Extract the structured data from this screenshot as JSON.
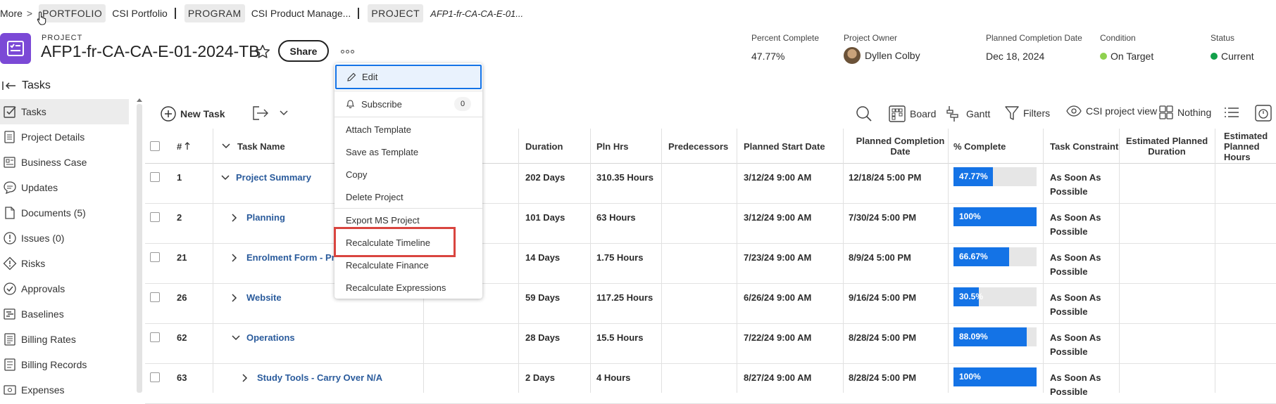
{
  "breadcrumb": {
    "more": "More",
    "portfolio_tag": "PORTFOLIO",
    "portfolio_name": "CSI Portfolio",
    "program_tag": "PROGRAM",
    "program_name": "CSI Product Manage...",
    "project_tag": "PROJECT",
    "project_name": "AFP1-fr-CA-CA-E-01..."
  },
  "header": {
    "label": "PROJECT",
    "title": "AFP1-fr-CA-CA-E-01-2024-TB",
    "share_label": "Share",
    "percent_complete_label": "Percent Complete",
    "percent_complete_value": "47.77%",
    "owner_label": "Project Owner",
    "owner_value": "Dyllen Colby",
    "planned_completion_label": "Planned Completion Date",
    "planned_completion_value": "Dec 18, 2024",
    "condition_label": "Condition",
    "condition_value": "On Target",
    "status_label": "Status",
    "status_value": "Current"
  },
  "colors": {
    "accent": "#1473e6",
    "project_icon": "#7b49d6",
    "condition_dot": "#8fd14f",
    "status_dot": "#12a04a",
    "highlight": "#d9453f",
    "task_link": "#2a5b9c"
  },
  "nav": {
    "title": "Tasks",
    "items": [
      {
        "label": "Tasks",
        "icon": "checkbox-icon"
      },
      {
        "label": "Project Details",
        "icon": "document-icon"
      },
      {
        "label": "Business Case",
        "icon": "business-case-icon"
      },
      {
        "label": "Updates",
        "icon": "chat-icon"
      },
      {
        "label": "Documents (5)",
        "icon": "file-icon"
      },
      {
        "label": "Issues (0)",
        "icon": "alert-icon"
      },
      {
        "label": "Risks",
        "icon": "warning-diamond-icon"
      },
      {
        "label": "Approvals",
        "icon": "approval-check-icon"
      },
      {
        "label": "Baselines",
        "icon": "baseline-icon"
      },
      {
        "label": "Billing Rates",
        "icon": "billing-rates-icon"
      },
      {
        "label": "Billing Records",
        "icon": "billing-records-icon"
      },
      {
        "label": "Expenses",
        "icon": "expenses-icon"
      }
    ]
  },
  "toolbar": {
    "new_task": "New Task",
    "board": "Board",
    "gantt": "Gantt",
    "filters": "Filters",
    "view": "CSI project view",
    "grouping": "Nothing"
  },
  "table": {
    "headers": {
      "num": "#",
      "task_name": "Task Name",
      "duration": "Duration",
      "pln_hrs": "Pln Hrs",
      "predecessors": "Predecessors",
      "planned_start": "Planned Start Date",
      "planned_completion_1": "Planned Completion",
      "planned_completion_2": "Date",
      "percent_complete": "% Complete",
      "task_constraint": "Task Constraint",
      "est_planned_duration_1": "Estimated Planned",
      "est_planned_duration_2": "Duration",
      "est_planned_hours_1": "Estimated",
      "est_planned_hours_2": "Planned Hours"
    },
    "rows": [
      {
        "num": "1",
        "name": "Project Summary",
        "expanded": true,
        "duration": "202 Days",
        "hours": "310.35 Hours",
        "start": "3/12/24 9:00 AM",
        "completion": "12/18/24 5:00 PM",
        "pct": 47.77,
        "pct_label": "47.77%",
        "constraint_1": "As Soon As",
        "constraint_2": "Possible"
      },
      {
        "num": "2",
        "name": "Planning",
        "expanded": false,
        "duration": "101 Days",
        "hours": "63 Hours",
        "start": "3/12/24 9:00 AM",
        "completion": "7/30/24 5:00 PM",
        "pct": 100,
        "pct_label": "100%",
        "constraint_1": "As Soon As",
        "constraint_2": "Possible"
      },
      {
        "num": "21",
        "name": "Enrolment Form - Pr",
        "expanded": false,
        "duration": "14 Days",
        "hours": "1.75 Hours",
        "start": "7/23/24 9:00 AM",
        "completion": "8/9/24 5:00 PM",
        "pct": 66.67,
        "pct_label": "66.67%",
        "constraint_1": "As Soon As",
        "constraint_2": "Possible"
      },
      {
        "num": "26",
        "name": "Website",
        "expanded": false,
        "duration": "59 Days",
        "hours": "117.25 Hours",
        "start": "6/26/24 9:00 AM",
        "completion": "9/16/24 5:00 PM",
        "pct": 30.5,
        "pct_label": "30.5%",
        "constraint_1": "As Soon As",
        "constraint_2": "Possible"
      },
      {
        "num": "62",
        "name": "Operations",
        "expanded": true,
        "duration": "28 Days",
        "hours": "15.5 Hours",
        "start": "7/22/24 9:00 AM",
        "completion": "8/28/24 5:00 PM",
        "pct": 88.09,
        "pct_label": "88.09%",
        "constraint_1": "As Soon As",
        "constraint_2": "Possible"
      },
      {
        "num": "63",
        "name": "Study Tools - Carry Over N/A",
        "expanded": false,
        "duration": "2 Days",
        "hours": "4 Hours",
        "start": "8/27/24 9:00 AM",
        "completion": "8/28/24 5:00 PM",
        "pct": 100,
        "pct_label": "100%",
        "constraint_1": "As Soon As",
        "constraint_2": "Possible"
      }
    ]
  },
  "menu": {
    "edit": "Edit",
    "subscribe": "Subscribe",
    "subscribe_count": "0",
    "attach_template": "Attach Template",
    "save_as_template": "Save as Template",
    "copy": "Copy",
    "delete_project": "Delete Project",
    "export_ms_project": "Export MS Project",
    "recalculate_timeline": "Recalculate Timeline",
    "recalculate_finance": "Recalculate Finance",
    "recalculate_expressions": "Recalculate Expressions"
  }
}
